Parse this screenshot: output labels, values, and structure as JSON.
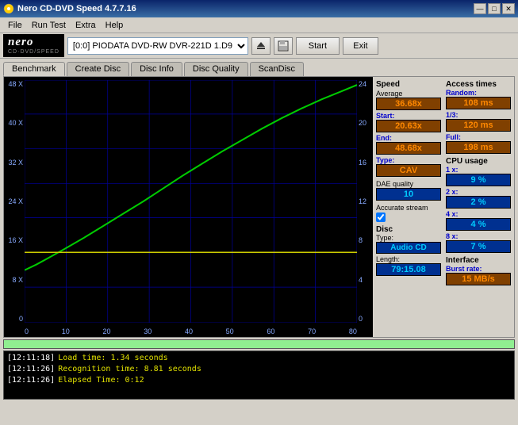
{
  "window": {
    "title": "Nero CD-DVD Speed 4.7.7.16",
    "icon": "cd-icon"
  },
  "titlebar": {
    "minimize_label": "—",
    "maximize_label": "□",
    "close_label": "✕"
  },
  "menubar": {
    "items": [
      {
        "label": "File"
      },
      {
        "label": "Run Test"
      },
      {
        "label": "Extra"
      },
      {
        "label": "Help"
      }
    ]
  },
  "toolbar": {
    "drive_label": "[0:0]  PIODATA DVD-RW DVR-221D 1.D9",
    "start_label": "Start",
    "exit_label": "Exit"
  },
  "tabs": [
    {
      "label": "Benchmark",
      "active": true
    },
    {
      "label": "Create Disc"
    },
    {
      "label": "Disc Info"
    },
    {
      "label": "Disc Quality"
    },
    {
      "label": "ScanDisc"
    }
  ],
  "chart": {
    "y_labels_left": [
      "0",
      "8 X",
      "16 X",
      "24 X",
      "32 X",
      "40 X",
      "48 X"
    ],
    "y_labels_right": [
      "0",
      "4",
      "8",
      "12",
      "16",
      "20",
      "24"
    ],
    "x_labels": [
      "0",
      "10",
      "20",
      "30",
      "40",
      "50",
      "60",
      "70",
      "80"
    ]
  },
  "speed_stats": {
    "section_label": "Speed",
    "average_label": "Average",
    "average_value": "36.68x",
    "start_label": "Start:",
    "start_value": "20.63x",
    "end_label": "End:",
    "end_value": "48.68x",
    "type_label": "Type:",
    "type_value": "CAV"
  },
  "access_times": {
    "section_label": "Access times",
    "random_label": "Random:",
    "random_value": "108 ms",
    "one_third_label": "1/3:",
    "one_third_value": "120 ms",
    "full_label": "Full:",
    "full_value": "198 ms"
  },
  "dae": {
    "label": "DAE quality",
    "value": "10"
  },
  "accurate_stream": {
    "label": "Accurate stream",
    "checked": true
  },
  "cpu_usage": {
    "section_label": "CPU usage",
    "one_x_label": "1 x:",
    "one_x_value": "9 %",
    "two_x_label": "2 x:",
    "two_x_value": "2 %",
    "four_x_label": "4 x:",
    "four_x_value": "4 %",
    "eight_x_label": "8 x:",
    "eight_x_value": "7 %"
  },
  "disc": {
    "type_label": "Disc",
    "type_sublabel": "Type:",
    "type_value": "Audio CD",
    "length_label": "Length:",
    "length_value": "79:15.08"
  },
  "interface": {
    "label": "Interface",
    "burst_label": "Burst rate:",
    "burst_value": "15 MB/s"
  },
  "log": {
    "lines": [
      {
        "time": "[12:11:18]",
        "message": " Load time: 1.34 seconds"
      },
      {
        "time": "[12:11:26]",
        "message": " Recognition time: 8.81 seconds"
      },
      {
        "time": "[12:11:26]",
        "message": " Elapsed Time: 0:12"
      }
    ]
  }
}
